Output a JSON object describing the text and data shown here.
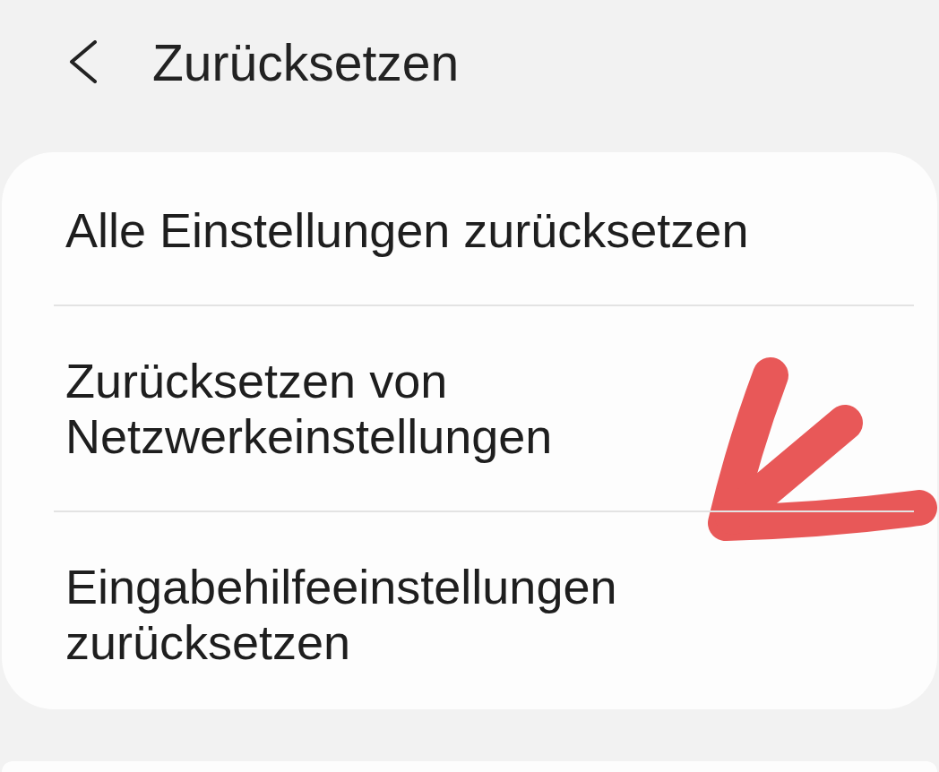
{
  "header": {
    "title": "Zurücksetzen"
  },
  "items": [
    {
      "label": "Alle Einstellungen zurücksetzen",
      "annotated": false
    },
    {
      "label": "Zurücksetzen von Netzwerkeinstellungen",
      "annotated": true
    },
    {
      "label": "Eingabehilfeeinstellungen zurücksetzen",
      "annotated": false
    }
  ]
}
